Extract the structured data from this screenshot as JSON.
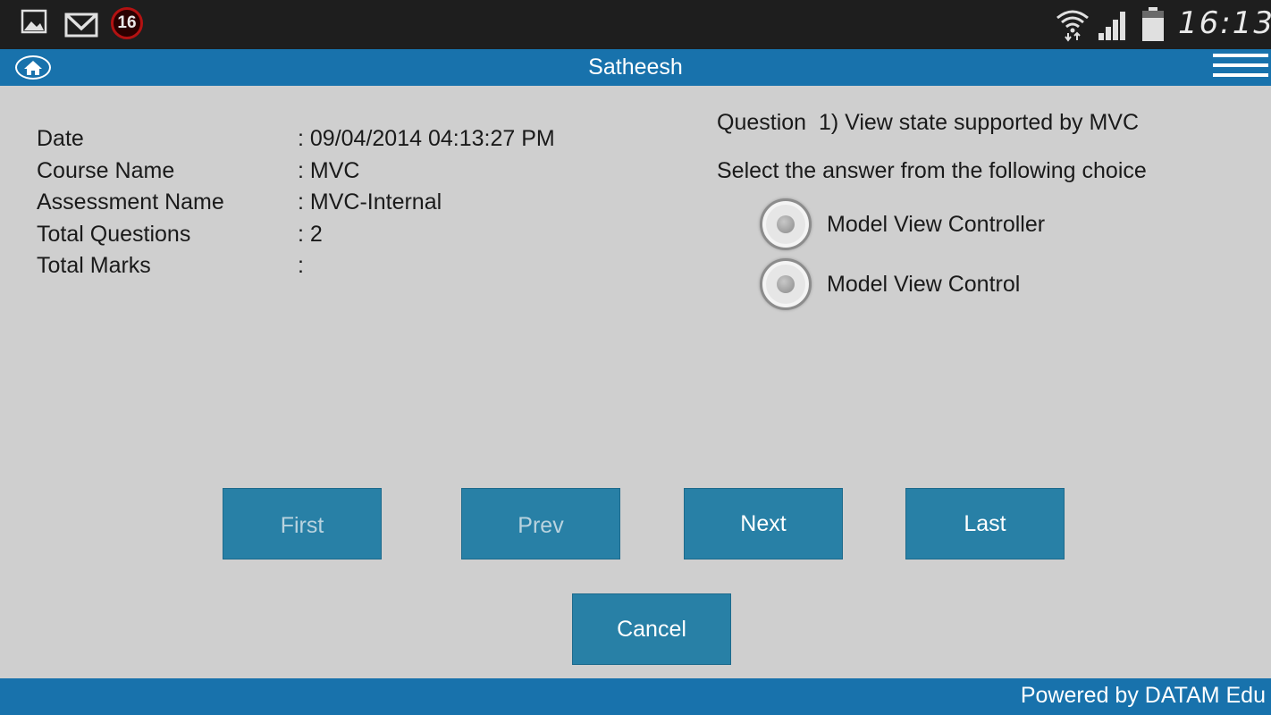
{
  "status_bar": {
    "icons": [
      "gallery-icon",
      "gmail-icon",
      "notification-badge",
      "wifi-icon",
      "signal-icon",
      "battery-icon"
    ],
    "badge_count": "16",
    "time": "16:13"
  },
  "header": {
    "title": "Satheesh",
    "home_icon": "home-icon",
    "menu_icon": "hamburger-menu-icon",
    "color": "#1872ac"
  },
  "info": {
    "rows": [
      {
        "label": "Date",
        "value": ": 09/04/2014 04:13:27 PM"
      },
      {
        "label": "Course Name",
        "value": ": MVC"
      },
      {
        "label": "Assessment Name",
        "value": ": MVC-Internal"
      },
      {
        "label": "Total Questions",
        "value": ": 2"
      },
      {
        "label": "Total Marks",
        "value": ":"
      }
    ]
  },
  "question": {
    "text": "Question  1) View state supported by MVC",
    "instruction": "Select the answer from the following choice",
    "choices": [
      {
        "label": "Model View Controller",
        "selected": false
      },
      {
        "label": "Model View Control",
        "selected": false
      }
    ]
  },
  "nav": {
    "first_label": "First",
    "prev_label": "Prev",
    "next_label": "Next",
    "last_label": "Last",
    "cancel_label": "Cancel",
    "button_color": "#2880a6"
  },
  "footer": {
    "text": "Powered by DATAM Edu"
  }
}
